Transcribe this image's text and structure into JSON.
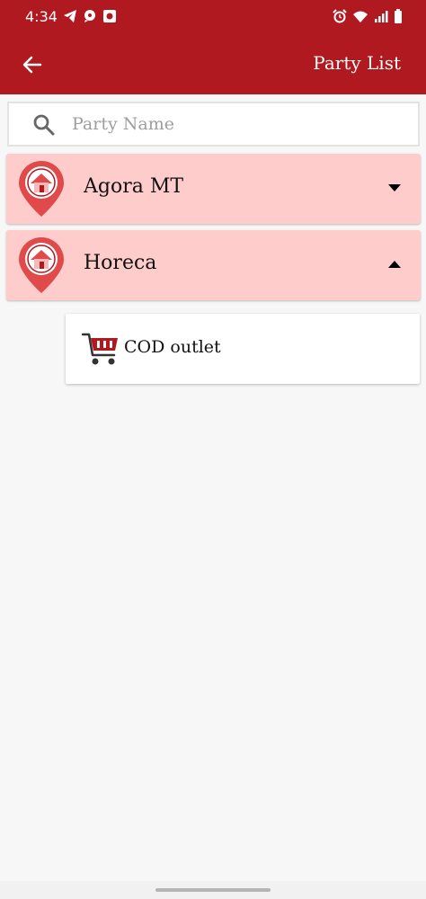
{
  "status_bar": {
    "time": "4:34",
    "left_icons": [
      "telegram-icon",
      "chat-icon",
      "app-icon"
    ],
    "right_icons": [
      "alarm-icon",
      "wifi-icon",
      "signal-icon",
      "battery-icon"
    ]
  },
  "app_bar": {
    "back_icon": "arrow-left-icon",
    "title": "Party List",
    "background": "#b0191f"
  },
  "search": {
    "placeholder": "Party Name",
    "value": ""
  },
  "groups": [
    {
      "label": "Agora MT",
      "expanded": false,
      "icon": "home-pin-icon"
    },
    {
      "label": "Horeca",
      "expanded": true,
      "icon": "home-pin-icon"
    }
  ],
  "children": [
    {
      "label": "COD outlet",
      "icon": "cart-icon"
    }
  ],
  "colors": {
    "accent": "#b0191f",
    "group_background": "#ffcccc",
    "page_background": "#f8f7f7"
  }
}
